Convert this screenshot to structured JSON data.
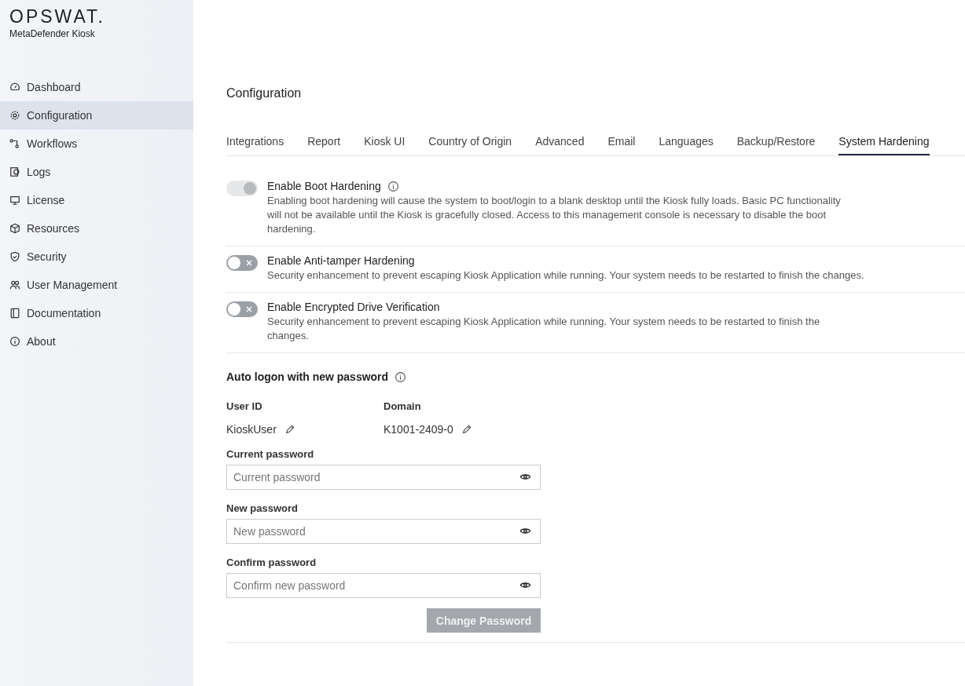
{
  "brand": {
    "logo": "OPSWAT.",
    "product": "MetaDefender Kiosk"
  },
  "sidebar": {
    "items": [
      {
        "label": "Dashboard",
        "selected": false
      },
      {
        "label": "Configuration",
        "selected": true
      },
      {
        "label": "Workflows",
        "selected": false
      },
      {
        "label": "Logs",
        "selected": false
      },
      {
        "label": "License",
        "selected": false
      },
      {
        "label": "Resources",
        "selected": false
      },
      {
        "label": "Security",
        "selected": false
      },
      {
        "label": "User Management",
        "selected": false
      },
      {
        "label": "Documentation",
        "selected": false
      },
      {
        "label": "About",
        "selected": false
      }
    ]
  },
  "page_title": "Configuration",
  "tabs": [
    {
      "label": "Integrations",
      "selected": false
    },
    {
      "label": "Report",
      "selected": false
    },
    {
      "label": "Kiosk UI",
      "selected": false
    },
    {
      "label": "Country of Origin",
      "selected": false
    },
    {
      "label": "Advanced",
      "selected": false
    },
    {
      "label": "Email",
      "selected": false
    },
    {
      "label": "Languages",
      "selected": false
    },
    {
      "label": "Backup/Restore",
      "selected": false
    },
    {
      "label": "System Hardening",
      "selected": true
    }
  ],
  "settings": [
    {
      "title": "Enable Boot Hardening",
      "info": true,
      "on": true,
      "disabled": true,
      "description": "Enabling boot hardening will cause the system to boot/login to a blank desktop until the Kiosk fully loads. Basic PC functionality will not be available until the Kiosk is gracefully closed. Access to this management console is necessary to disable the boot hardening."
    },
    {
      "title": "Enable Anti-tamper Hardening",
      "info": false,
      "on": false,
      "disabled": false,
      "description": "Security enhancement to prevent escaping Kiosk Application while running. Your system needs to be restarted to finish the changes."
    },
    {
      "title": "Enable Encrypted Drive Verification",
      "info": false,
      "on": false,
      "disabled": false,
      "description": "Security enhancement to prevent escaping Kiosk Application while running. Your system needs to be restarted to finish the changes."
    }
  ],
  "auto_logon": {
    "title": "Auto logon with new password",
    "fields": [
      {
        "label": "User ID",
        "value": "KioskUser"
      },
      {
        "label": "Domain",
        "value": "K1001-2409-0"
      }
    ],
    "passwords": [
      {
        "label": "Current password",
        "placeholder": "Current password"
      },
      {
        "label": "New password",
        "placeholder": "New password"
      },
      {
        "label": "Confirm password",
        "placeholder": "Confirm new password"
      }
    ],
    "button": {
      "label": "Change Password",
      "disabled": true
    }
  }
}
